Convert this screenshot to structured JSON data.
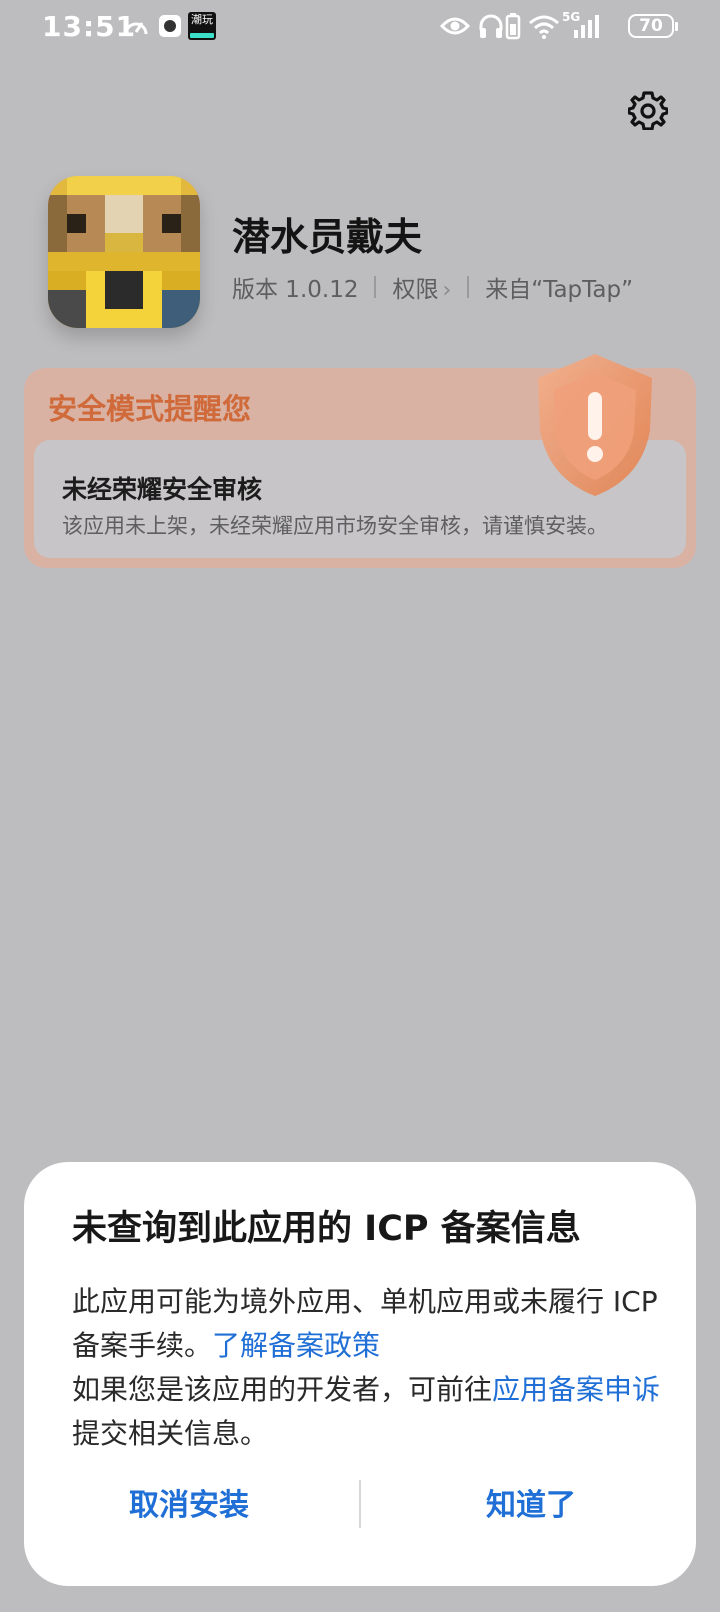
{
  "status_bar": {
    "time": "13:51",
    "notif_badge": "潮玩",
    "network": "5G",
    "battery": "70",
    "icons": [
      "speed-icon",
      "app-notification-icon",
      "eye-icon",
      "headphones-icon",
      "battery-saver-icon",
      "wifi-icon",
      "signal-icon"
    ]
  },
  "app": {
    "name": "潜水员戴夫",
    "version": "版本 1.0.12",
    "permissions": "权限",
    "source": "来自“TapTap”"
  },
  "safety": {
    "title": "安全模式提醒您",
    "heading": "未经荣耀安全审核",
    "desc": "该应用未上架，未经荣耀应用市场安全审核，请谨慎安装。",
    "accent": "#d06a3a"
  },
  "dialog": {
    "title": "未查询到此应用的 ICP 备案信息",
    "body_1": "此应用可能为境外应用、单机应用或未履行 ICP 备案手续。",
    "link_1": "了解备案政策",
    "body_2": "如果您是该应用的开发者，可前往",
    "link_2": "应用备案申诉",
    "body_3": "提交相关信息。",
    "cancel_label": "取消安装",
    "ok_label": "知道了",
    "link_color": "#1f6fd6"
  }
}
